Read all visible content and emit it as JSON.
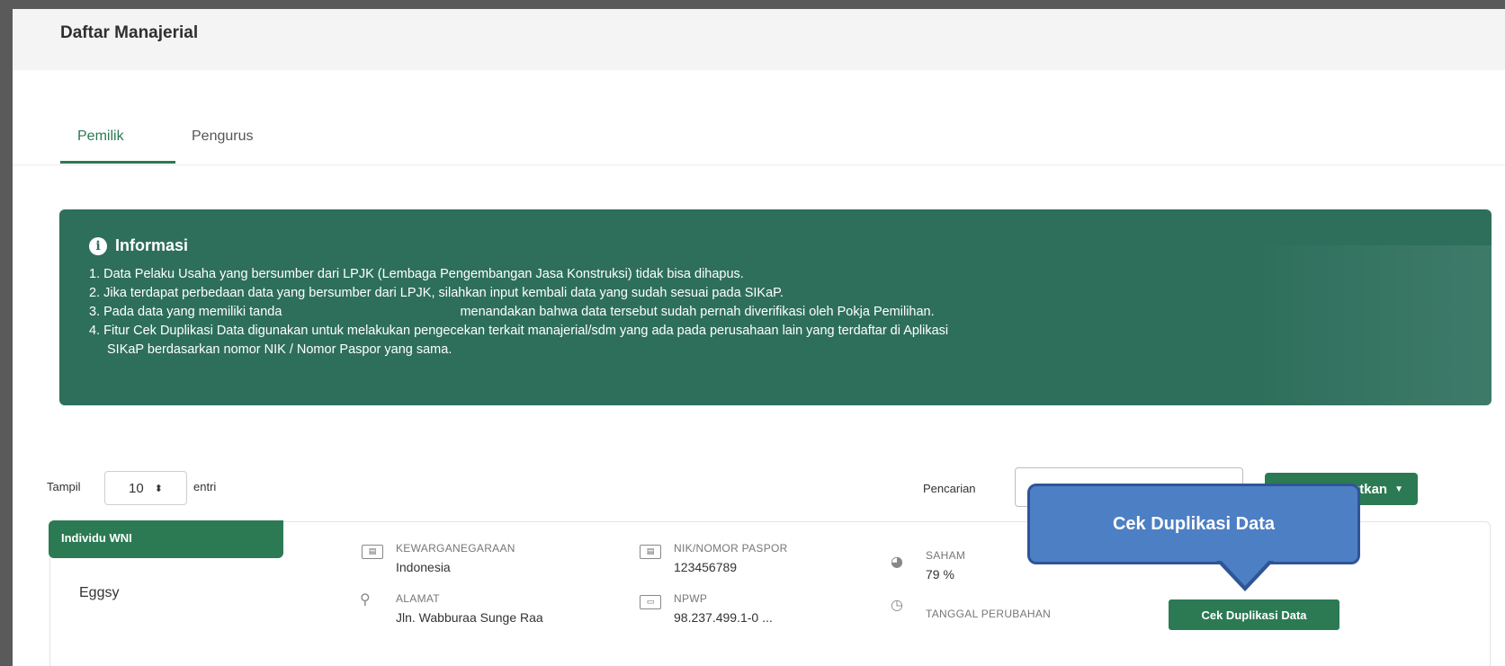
{
  "header": {
    "title": "Daftar Manajerial"
  },
  "tabs": [
    {
      "label": "Pemilik",
      "active": true
    },
    {
      "label": "Pengurus",
      "active": false
    }
  ],
  "info": {
    "title": "Informasi",
    "lines": [
      "1. Data Pelaku Usaha yang bersumber dari LPJK (Lembaga Pengembangan Jasa Konstruksi) tidak bisa dihapus.",
      "2. Jika terdapat perbedaan data yang bersumber dari LPJK, silahkan input kembali data yang sudah sesuai pada SIKaP.",
      "3. Pada data yang memiliki tanda",
      "menandakan bahwa data tersebut sudah pernah diverifikasi oleh Pokja Pemilihan.",
      "4. Fitur Cek Duplikasi Data digunakan untuk melakukan pengecekan terkait manajerial/sdm yang ada pada perusahaan lain yang terdaftar di Aplikasi",
      "SIKaP berdasarkan nomor NIK / Nomor Paspor yang sama."
    ]
  },
  "controls": {
    "show_label": "Tampil",
    "page_size": "10",
    "entries_label": "entri",
    "search_label": "Pencarian",
    "search_value": "",
    "sort_label": "Urutkan"
  },
  "card": {
    "badge": "Individu WNI",
    "name": "Eggsy",
    "fields": {
      "kewarganegaraan_label": "KEWARGANEGARAAN",
      "kewarganegaraan_value": "Indonesia",
      "nik_label": "NIK/NOMOR PASPOR",
      "nik_value": "123456789",
      "saham_label": "SAHAM",
      "saham_value": "79 %",
      "alamat_label": "ALAMAT",
      "alamat_value": "Jln. Wabburaa Sunge Raa",
      "npwp_label": "NPWP",
      "npwp_value": "98.237.499.1-0 ...",
      "tanggal_label": "TANGGAL PERUBAHAN"
    },
    "dup_button": "Cek Duplikasi Data"
  },
  "callout": {
    "text": "Cek Duplikasi Data"
  },
  "colors": {
    "accent": "#2c7a53",
    "info_bg": "#2e6f5c",
    "callout_fill": "#4d7fc4",
    "callout_border": "#2f5597"
  }
}
